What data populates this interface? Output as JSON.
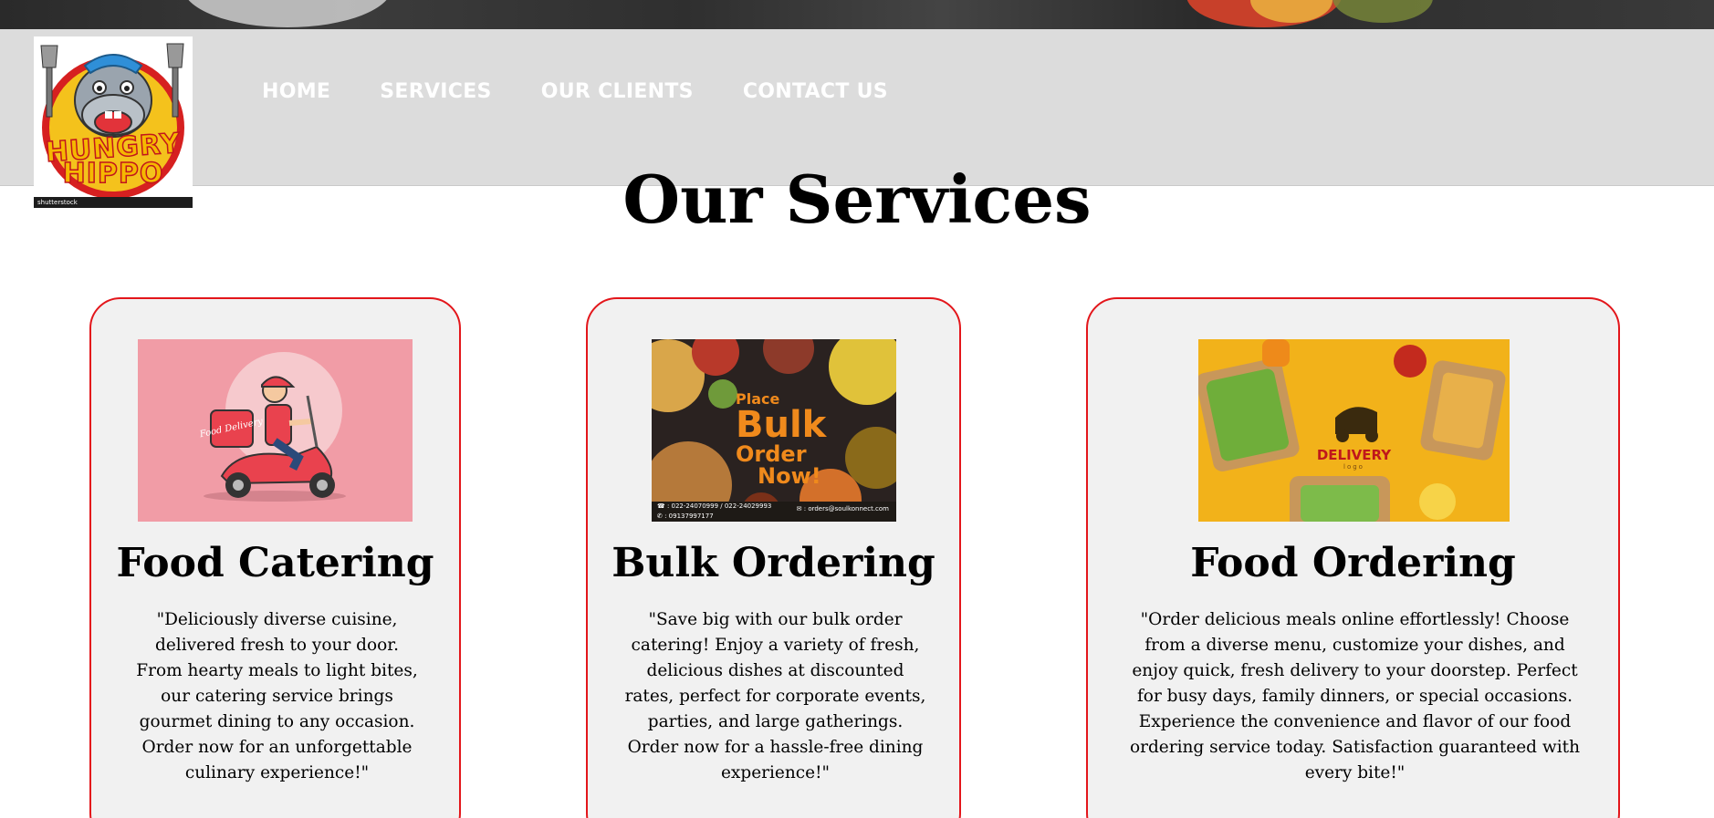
{
  "brand": {
    "logo_line1": "HUNGRY",
    "logo_line2": "HIPPO",
    "logo_watermark": "shutterstock"
  },
  "nav": {
    "items": [
      {
        "label": "HOME"
      },
      {
        "label": "SERVICES"
      },
      {
        "label": "OUR CLIENTS"
      },
      {
        "label": "CONTACT US"
      }
    ]
  },
  "page": {
    "title": "Our Services"
  },
  "services": [
    {
      "title": "Food Catering",
      "description": "\"Deliciously diverse cuisine, delivered fresh to your door. From hearty meals to light bites, our catering service brings gourmet dining to any occasion. Order now for an unforgettable culinary experience!\"",
      "image_text": "Food Delivery"
    },
    {
      "title": "Bulk Ordering",
      "description": "\"Save big with our bulk order catering! Enjoy a variety of fresh, delicious dishes at discounted rates, perfect for corporate events, parties, and large gatherings. Order now for a hassle-free dining experience!\"",
      "image_text": {
        "line1": "Place",
        "line2": "Bulk",
        "line3": "Order",
        "line4": "Now!",
        "phone": "☎ : 022-24070999 / 022-24029993",
        "mobile": "✆ : 09137997177",
        "email": "✉ : orders@soulkonnect.com"
      }
    },
    {
      "title": "Food Ordering",
      "description": "\"Order delicious meals online effortlessly! Choose from a diverse menu, customize your dishes, and enjoy quick, fresh delivery to your doorstep. Perfect for busy days, family dinners, or special occasions. Experience the convenience and flavor of our food ordering service today. Satisfaction guaranteed with every bite!\"",
      "image_text": {
        "title": "DELIVERY",
        "sub": "logo"
      }
    }
  ],
  "colors": {
    "header_bg": "#dcdcdc",
    "card_border": "#e3161b",
    "card_bg": "#f1f1f1",
    "nav_text": "#ffffff"
  }
}
